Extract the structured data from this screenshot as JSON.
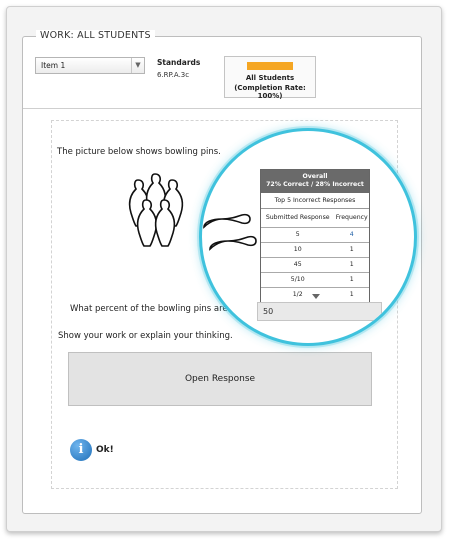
{
  "header": {
    "legend": "WORK:  ALL STUDENTS",
    "item_select": {
      "value": "Item 1"
    },
    "standards": {
      "label": "Standards",
      "code": "6.RP.A.3c"
    },
    "class_card": {
      "title": "All Students",
      "completion": "(Completion Rate: 100%)",
      "bar_color": "#f5a623"
    }
  },
  "question": {
    "prompt": "The picture below shows bowling pins.",
    "ask": "What percent of the bowling pins are standing?",
    "answer_value": "50",
    "unit": "%",
    "show_work": "Show your work or explain your thinking.",
    "open_response_label": "Open Response"
  },
  "feedback": {
    "icon": "info-icon",
    "label": "Ok!"
  },
  "stats_popup": {
    "title": "Overall",
    "summary": "72% Correct / 28% Incorrect",
    "subtitle": "Top 5 Incorrect Responses",
    "columns": [
      "Submitted Response",
      "Frequency"
    ],
    "rows": [
      {
        "response": "5",
        "frequency": "4"
      },
      {
        "response": "10",
        "frequency": "1"
      },
      {
        "response": "45",
        "frequency": "1"
      },
      {
        "response": "5/10",
        "frequency": "1"
      },
      {
        "response": "1/2",
        "frequency": "1"
      }
    ],
    "magnifier_color": "#3fc2dd"
  }
}
